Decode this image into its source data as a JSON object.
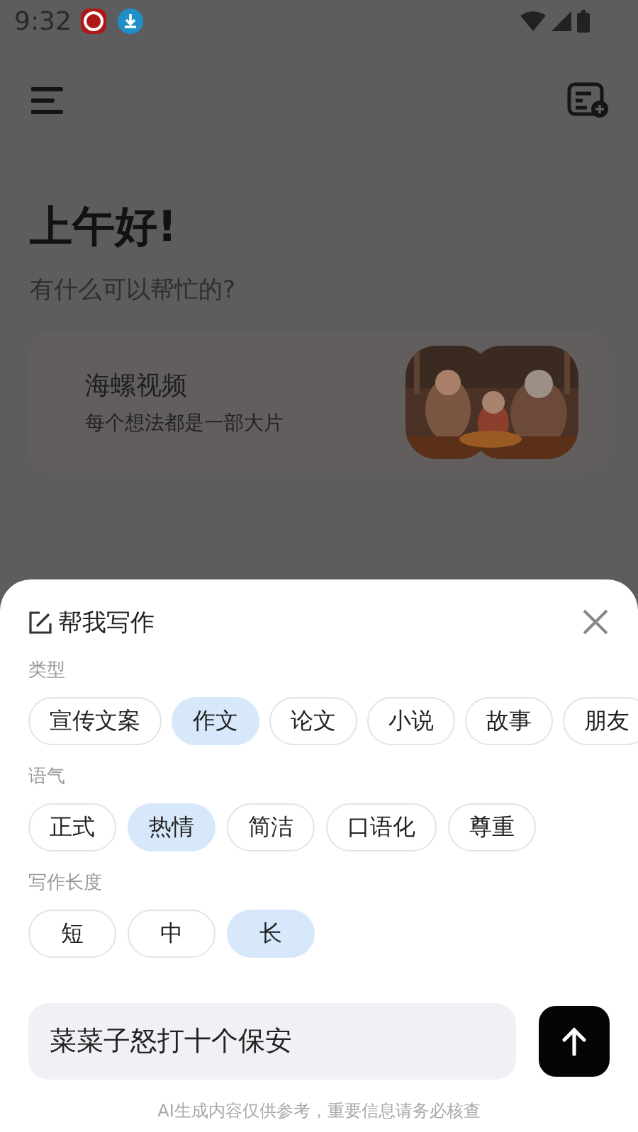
{
  "status_bar": {
    "time": "9:32"
  },
  "greeting": "上午好!",
  "subtitle": "有什么可以帮忙的?",
  "promo_card": {
    "title": "海螺视频",
    "subtitle": "每个想法都是一部大片"
  },
  "sheet": {
    "title": "帮我写作",
    "groups": [
      {
        "label": "类型",
        "options": [
          {
            "label": "宣传文案",
            "selected": false
          },
          {
            "label": "作文",
            "selected": true
          },
          {
            "label": "论文",
            "selected": false
          },
          {
            "label": "小说",
            "selected": false
          },
          {
            "label": "故事",
            "selected": false
          },
          {
            "label": "朋友",
            "selected": false
          }
        ]
      },
      {
        "label": "语气",
        "options": [
          {
            "label": "正式",
            "selected": false
          },
          {
            "label": "热情",
            "selected": true
          },
          {
            "label": "简洁",
            "selected": false
          },
          {
            "label": "口语化",
            "selected": false
          },
          {
            "label": "尊重",
            "selected": false
          }
        ]
      },
      {
        "label": "写作长度",
        "options": [
          {
            "label": "短",
            "selected": false
          },
          {
            "label": "中",
            "selected": false
          },
          {
            "label": "长",
            "selected": true
          }
        ]
      }
    ],
    "input": {
      "value": "菜菜子怒打十个保安"
    },
    "disclaimer": "AI生成内容仅供参考，重要信息请务必核查"
  }
}
